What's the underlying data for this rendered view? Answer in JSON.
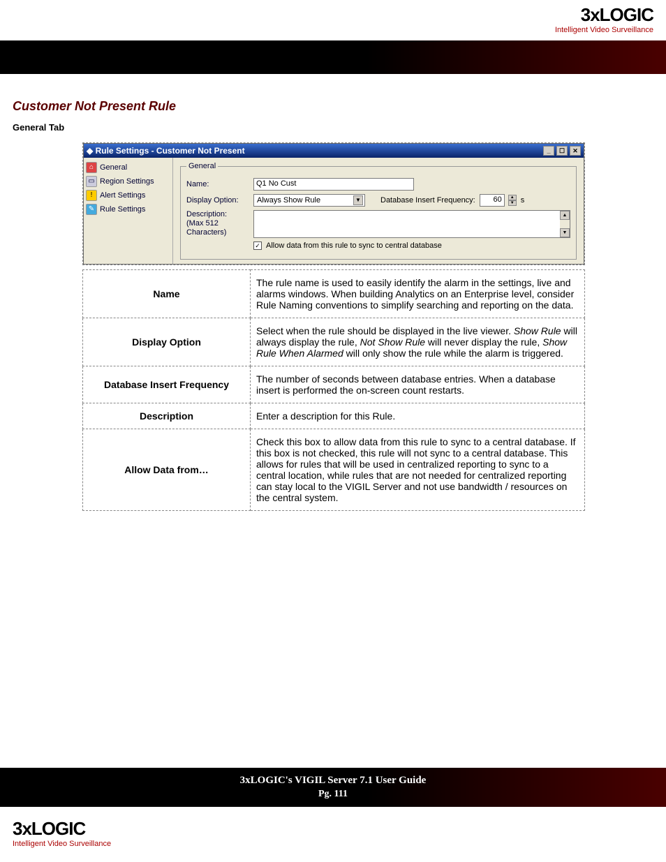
{
  "brand": {
    "logo_text": "3xLOGIC",
    "tagline": "Intelligent Video Surveillance"
  },
  "page": {
    "title": "Customer Not Present Rule",
    "subtitle": "General Tab"
  },
  "screenshot": {
    "window_title": "Rule Settings - Customer Not Present",
    "nav": {
      "general": "General",
      "region": "Region Settings",
      "alert": "Alert Settings",
      "rule": "Rule Settings"
    },
    "form": {
      "group_legend": "General",
      "name_label": "Name:",
      "name_value": "Q1 No Cust",
      "display_label": "Display Option:",
      "display_value": "Always Show Rule",
      "dbfreq_label": "Database Insert Frequency:",
      "dbfreq_value": "60",
      "dbfreq_unit": "s",
      "desc_label": "Description:",
      "desc_hint": "(Max 512 Characters)",
      "sync_label": "Allow data from this rule to sync to central database"
    }
  },
  "rows": {
    "name": {
      "label": "Name",
      "text": "The rule name is used to easily identify the alarm in the settings, live and alarms windows.  When building Analytics on an Enterprise level, consider Rule Naming conventions to simplify searching and reporting on the data."
    },
    "display": {
      "label": "Display Option",
      "pre": "Select when the rule should be displayed in the live viewer. ",
      "i1": "Show Rule",
      "mid1": " will always display the rule, ",
      "i2": "Not Show Rule",
      "mid2": " will never display the rule, ",
      "i3": "Show Rule When Alarmed",
      "post": " will only show the rule while the alarm is triggered."
    },
    "dbfreq": {
      "label": "Database Insert Frequency",
      "text": "The number of seconds between database entries. When a database insert is performed the on-screen count restarts."
    },
    "desc": {
      "label": "Description",
      "text": "Enter a description for this Rule."
    },
    "allow": {
      "label": "Allow Data from…",
      "text": "Check this box to allow data from this rule to sync to a central database.  If this box is not checked, this rule will not sync to a central database.  This allows for rules that will be used in centralized reporting to sync to a central location, while rules that are not needed for centralized reporting can stay local to the VIGIL Server and not use bandwidth / resources on the central system."
    }
  },
  "footer": {
    "line1": "3xLOGIC's VIGIL Server 7.1 User Guide",
    "line2": "Pg. 111"
  }
}
